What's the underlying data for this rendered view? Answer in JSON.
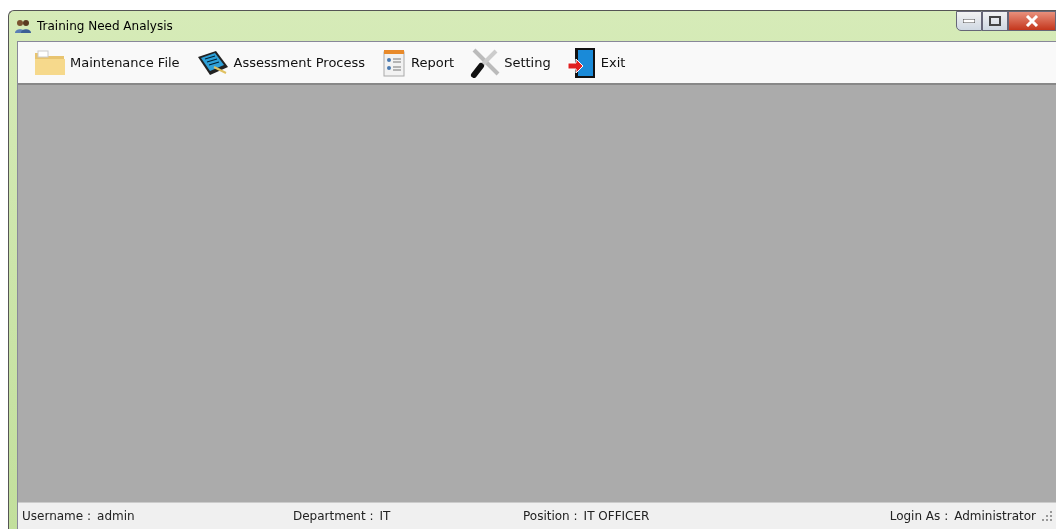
{
  "window": {
    "title": "Training Need Analysis"
  },
  "toolbar": [
    {
      "kind": "folder",
      "label": "Maintenance File"
    },
    {
      "kind": "tablet",
      "label": "Assessment Process"
    },
    {
      "kind": "report",
      "label": "Report"
    },
    {
      "kind": "tools",
      "label": "Setting"
    },
    {
      "kind": "exit",
      "label": "Exit"
    }
  ],
  "status_bar": [
    {
      "label": "Username :",
      "value": "admin"
    },
    {
      "label": "Department :",
      "value": "IT"
    },
    {
      "label": "Position :",
      "value": "IT OFFICER"
    },
    {
      "label": "Login As :",
      "value": "Administrator"
    }
  ]
}
